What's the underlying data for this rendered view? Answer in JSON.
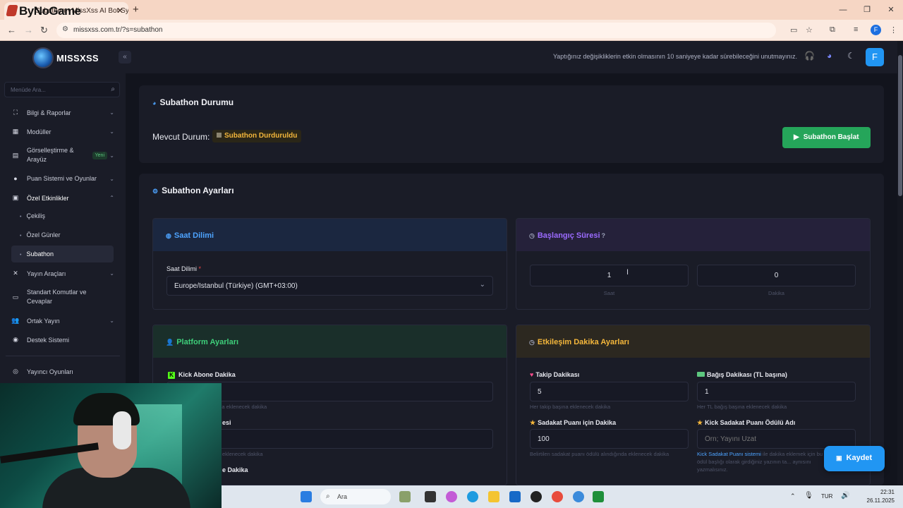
{
  "browser": {
    "tab_title": "Subathon - MissXss AI Bot Sys",
    "tab_close": "✕",
    "new_tab": "+",
    "overlay_logo": "ByNoGame",
    "url": "missxss.com.tr/?s=subathon",
    "profile_initial": "F",
    "window_controls": [
      "—",
      "❐",
      "✕"
    ]
  },
  "brand": {
    "name": "MISSXSS"
  },
  "sidebar": {
    "search_placeholder": "Menüde Ara...",
    "items": [
      {
        "label": "Bilgi & Raporlar",
        "icon": "expand-icon"
      },
      {
        "label": "Modüller",
        "icon": "grid-icon"
      },
      {
        "label": "Görselleştirme & Arayüz",
        "icon": "paint-icon",
        "badge": "Yeni"
      },
      {
        "label": "Puan Sistemi ve Oyunlar",
        "icon": "coins-icon"
      },
      {
        "label": "Özel Etkinlikler",
        "icon": "calendar-icon"
      },
      {
        "label": "Yayın Araçları",
        "icon": "tools-icon"
      },
      {
        "label": "Standart Komutlar ve Cevaplar",
        "icon": "terminal-icon"
      },
      {
        "label": "Ortak Yayın",
        "icon": "users-icon"
      },
      {
        "label": "Destek Sistemi",
        "icon": "support-icon"
      },
      {
        "label": "Yayıncı Oyunları",
        "icon": "gamepad-icon"
      }
    ],
    "sub_items": [
      "Çekiliş",
      "Özel Günler",
      "Subathon"
    ]
  },
  "topbar": {
    "notice": "Yaptığınız değişikliklerin etkin olmasının 10 saniyeye kadar sürebileceğini unutmayınız.",
    "user_initial": "F"
  },
  "status_card": {
    "title": "Subathon Durumu",
    "current_label": "Mevcut Durum:",
    "status_value": "Subathon Durduruldu",
    "start_button": "Subathon Başlat"
  },
  "settings_card": {
    "title": "Subathon Ayarları",
    "timezone": {
      "header": "Saat Dilimi",
      "field_label": "Saat Dilimi",
      "required": "*",
      "value": "Europe/Istanbul (Türkiye) (GMT+03:00)"
    },
    "start_duration": {
      "header": "Başlangıç Süresi",
      "hours_value": "1",
      "hours_label": "Saat",
      "minutes_value": "0",
      "minutes_label": "Dakika"
    },
    "platform": {
      "header": "Platform Ayarları",
      "kick_sub_label": "Kick Abone Dakika",
      "kick_sub_help": "Kick abone olunduğunda eklenecek dakika",
      "row2_label_fragment": "esi",
      "row2_help_fragment": "eklenecek dakika",
      "row3_label_fragment": "e Dakika"
    },
    "interaction": {
      "header": "Etkileşim Dakika Ayarları",
      "follow_label": "Takip Dakikası",
      "follow_value": "5",
      "follow_help": "Her takip başına eklenecek dakika",
      "donation_label": "Bağış Dakikası (TL başına)",
      "donation_value": "1",
      "donation_help": "Her TL bağış başına eklenecek dakika",
      "loyalty_label": "Sadakat Puanı için Dakika",
      "loyalty_value": "100",
      "loyalty_help": "Belirtilen sadakat puanı ödülü alındığında eklenecek dakika",
      "reward_label": "Kick Sadakat Puanı Ödülü Adı",
      "reward_placeholder": "Örn; Yayını Uzat",
      "reward_help_link": "Kick Sadakat Puanı sistemi",
      "reward_help_rest": "ile dakika eklemek için bu alana ödül başlığı olarak girdiğiniz yazının ta... aynısını yazmalısınız."
    }
  },
  "save_button": "Kaydet",
  "taskbar": {
    "search_placeholder": "Ara",
    "language": "TUR",
    "time": "22:31",
    "date": "26.11.2025"
  },
  "colors": {
    "accent_blue": "#2196f3",
    "start_green": "#25a55a",
    "status_amber": "#f5b73b",
    "timezone_blue": "#4da3ff",
    "duration_purple": "#9b6bff",
    "platform_green": "#3ecf7a",
    "interaction_amber": "#f5b73b"
  }
}
